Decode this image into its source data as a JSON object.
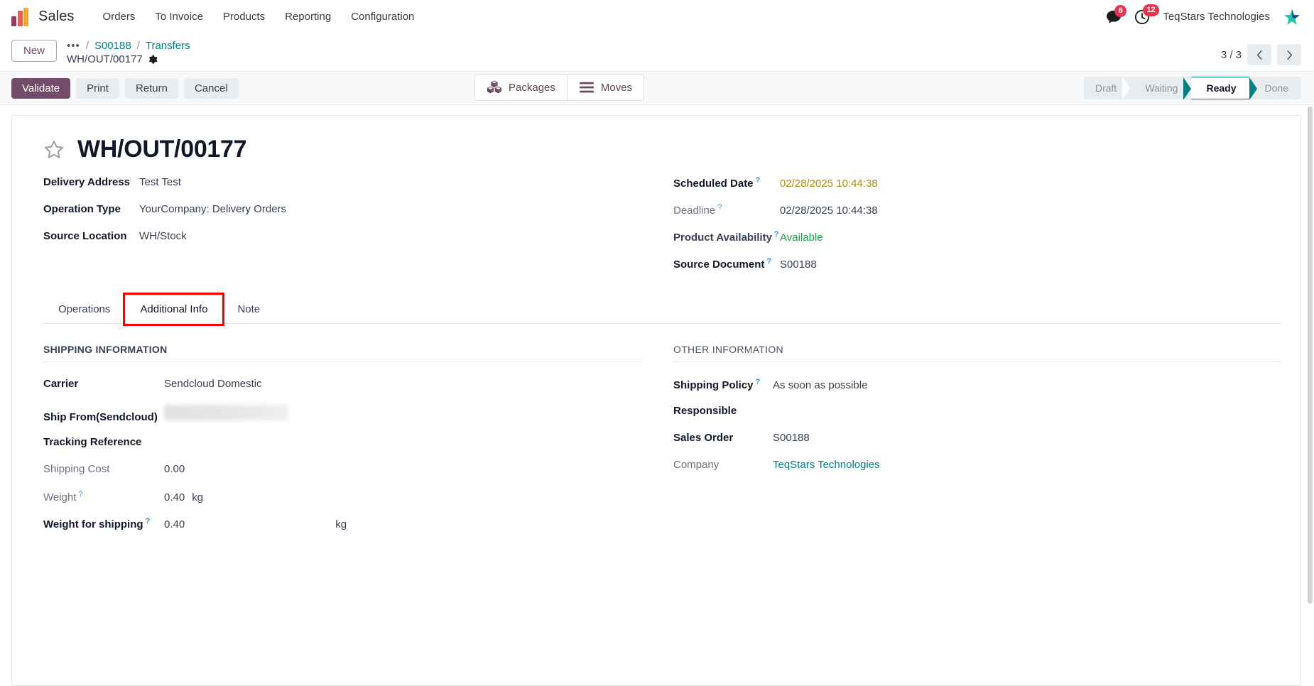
{
  "navbar": {
    "app_name": "Sales",
    "menu": [
      {
        "label": "Orders"
      },
      {
        "label": "To Invoice"
      },
      {
        "label": "Products"
      },
      {
        "label": "Reporting"
      },
      {
        "label": "Configuration"
      }
    ],
    "messages_badge": "6",
    "activities_badge": "12",
    "company": "TeqStars Technologies",
    "messages_icon": "chat-bubble-icon",
    "activities_icon": "clock-icon",
    "star_icon": "star-brand-icon"
  },
  "controlpanel": {
    "new_label": "New",
    "breadcrumb_dots": "•••",
    "breadcrumb_items": [
      {
        "label": "S00188"
      },
      {
        "label": "Transfers"
      }
    ],
    "record_name": "WH/OUT/00177",
    "stat_buttons": [
      {
        "label": "Packages",
        "icon": "boxes-icon"
      },
      {
        "label": "Moves",
        "icon": "list-lines-icon"
      }
    ],
    "pager": "3 / 3",
    "prev_icon": "chevron-left-icon",
    "next_icon": "chevron-right-icon"
  },
  "actions": {
    "buttons": [
      {
        "label": "Validate",
        "style": "primary"
      },
      {
        "label": "Print",
        "style": "secondary"
      },
      {
        "label": "Return",
        "style": "secondary"
      },
      {
        "label": "Cancel",
        "style": "secondary"
      }
    ]
  },
  "status_bar": {
    "stages": [
      {
        "label": "Draft",
        "active": false
      },
      {
        "label": "Waiting",
        "active": false
      },
      {
        "label": "Ready",
        "active": true
      },
      {
        "label": "Done",
        "active": false
      }
    ],
    "active_color": "#017e84"
  },
  "record": {
    "title": "WH/OUT/00177",
    "favorite_icon": "star-outline-icon",
    "left_fields": [
      {
        "label": "Delivery Address",
        "value": "Test Test"
      },
      {
        "label": "Operation Type",
        "value": "YourCompany: Delivery Orders"
      },
      {
        "label": "Source Location",
        "value": "WH/Stock"
      }
    ],
    "right_fields": [
      {
        "label": "Scheduled Date",
        "value": "02/28/2025 10:44:38",
        "help": "?",
        "color": "amber",
        "bold": true
      },
      {
        "label": "Deadline",
        "value": "02/28/2025 10:44:38",
        "help": "?",
        "color": "normal",
        "bold": false
      },
      {
        "label": "Product Availability",
        "value": "Available",
        "help": "?",
        "color": "green",
        "bold": false
      },
      {
        "label": "Source Document",
        "value": "S00188",
        "help": "?",
        "color": "normal",
        "bold": true
      }
    ]
  },
  "notebook": {
    "tabs": [
      {
        "label": "Operations",
        "active": false,
        "highlighted": false
      },
      {
        "label": "Additional Info",
        "active": true,
        "highlighted": true
      },
      {
        "label": "Note",
        "active": false,
        "highlighted": false
      }
    ],
    "highlight_color": "#ff0000",
    "shipping_section": {
      "heading": "SHIPPING INFORMATION",
      "rows": [
        {
          "label": "Carrier",
          "value": "Sendcloud Domestic",
          "bold": true,
          "redacted": false,
          "unit": ""
        },
        {
          "label": "Ship From(Sendcloud)",
          "value": "",
          "bold": true,
          "redacted": true,
          "unit": ""
        },
        {
          "label": "Tracking Reference",
          "value": "",
          "bold": true,
          "redacted": false,
          "unit": ""
        },
        {
          "label": "Shipping Cost",
          "value": "0.00",
          "bold": false,
          "redacted": false,
          "unit": ""
        },
        {
          "label": "Weight",
          "value": "0.40",
          "bold": false,
          "redacted": false,
          "unit": "kg",
          "help": "?"
        },
        {
          "label": "Weight for shipping",
          "value": "0.40",
          "bold": true,
          "redacted": false,
          "unit": "kg",
          "help": "?",
          "unit_far": true
        }
      ]
    },
    "other_section": {
      "heading": "OTHER INFORMATION",
      "rows": [
        {
          "label": "Shipping Policy",
          "value": "As soon as possible",
          "bold": true,
          "help": "?",
          "link": false
        },
        {
          "label": "Responsible",
          "value": "",
          "bold": true,
          "link": false
        },
        {
          "label": "Sales Order",
          "value": "S00188",
          "bold": true,
          "link": false
        },
        {
          "label": "Company",
          "value": "TeqStars Technologies",
          "bold": false,
          "link": true
        }
      ]
    }
  }
}
